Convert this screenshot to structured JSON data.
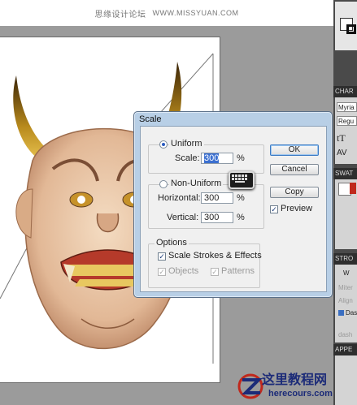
{
  "watermark": {
    "text": "思缘设计论坛",
    "url": "WWW.MISSYUAN.COM"
  },
  "dialog": {
    "title": "Scale",
    "uniform": {
      "label": "Uniform",
      "scale_label": "Scale:",
      "scale_value": "300",
      "unit": "%"
    },
    "non_uniform": {
      "label": "Non-Uniform",
      "horizontal_label": "Horizontal:",
      "horizontal_value": "300",
      "vertical_label": "Vertical:",
      "vertical_value": "300",
      "unit": "%"
    },
    "options": {
      "label": "Options",
      "scale_strokes": "Scale Strokes & Effects",
      "objects": "Objects",
      "patterns": "Patterns"
    },
    "buttons": {
      "ok": "OK",
      "cancel": "Cancel",
      "copy": "Copy"
    },
    "preview": "Preview"
  },
  "right_panels": {
    "character_tab": "CHAR",
    "font_name": "Myria",
    "font_style": "Regu",
    "swatches_tab": "SWAT",
    "stroke_tab": "STRO",
    "stroke_w": "W",
    "stroke_miter": "Miter",
    "stroke_align": "Align",
    "stroke_dashed": "Das",
    "stroke_dash": "dash",
    "appearance_tab": "APPE"
  },
  "logo": {
    "name": "这里教程网",
    "url": "herecours.com"
  },
  "colors": {
    "dialog_frame": "#b8cfe6",
    "selection": "#3b6fd0",
    "logo": "#1c2b78"
  }
}
